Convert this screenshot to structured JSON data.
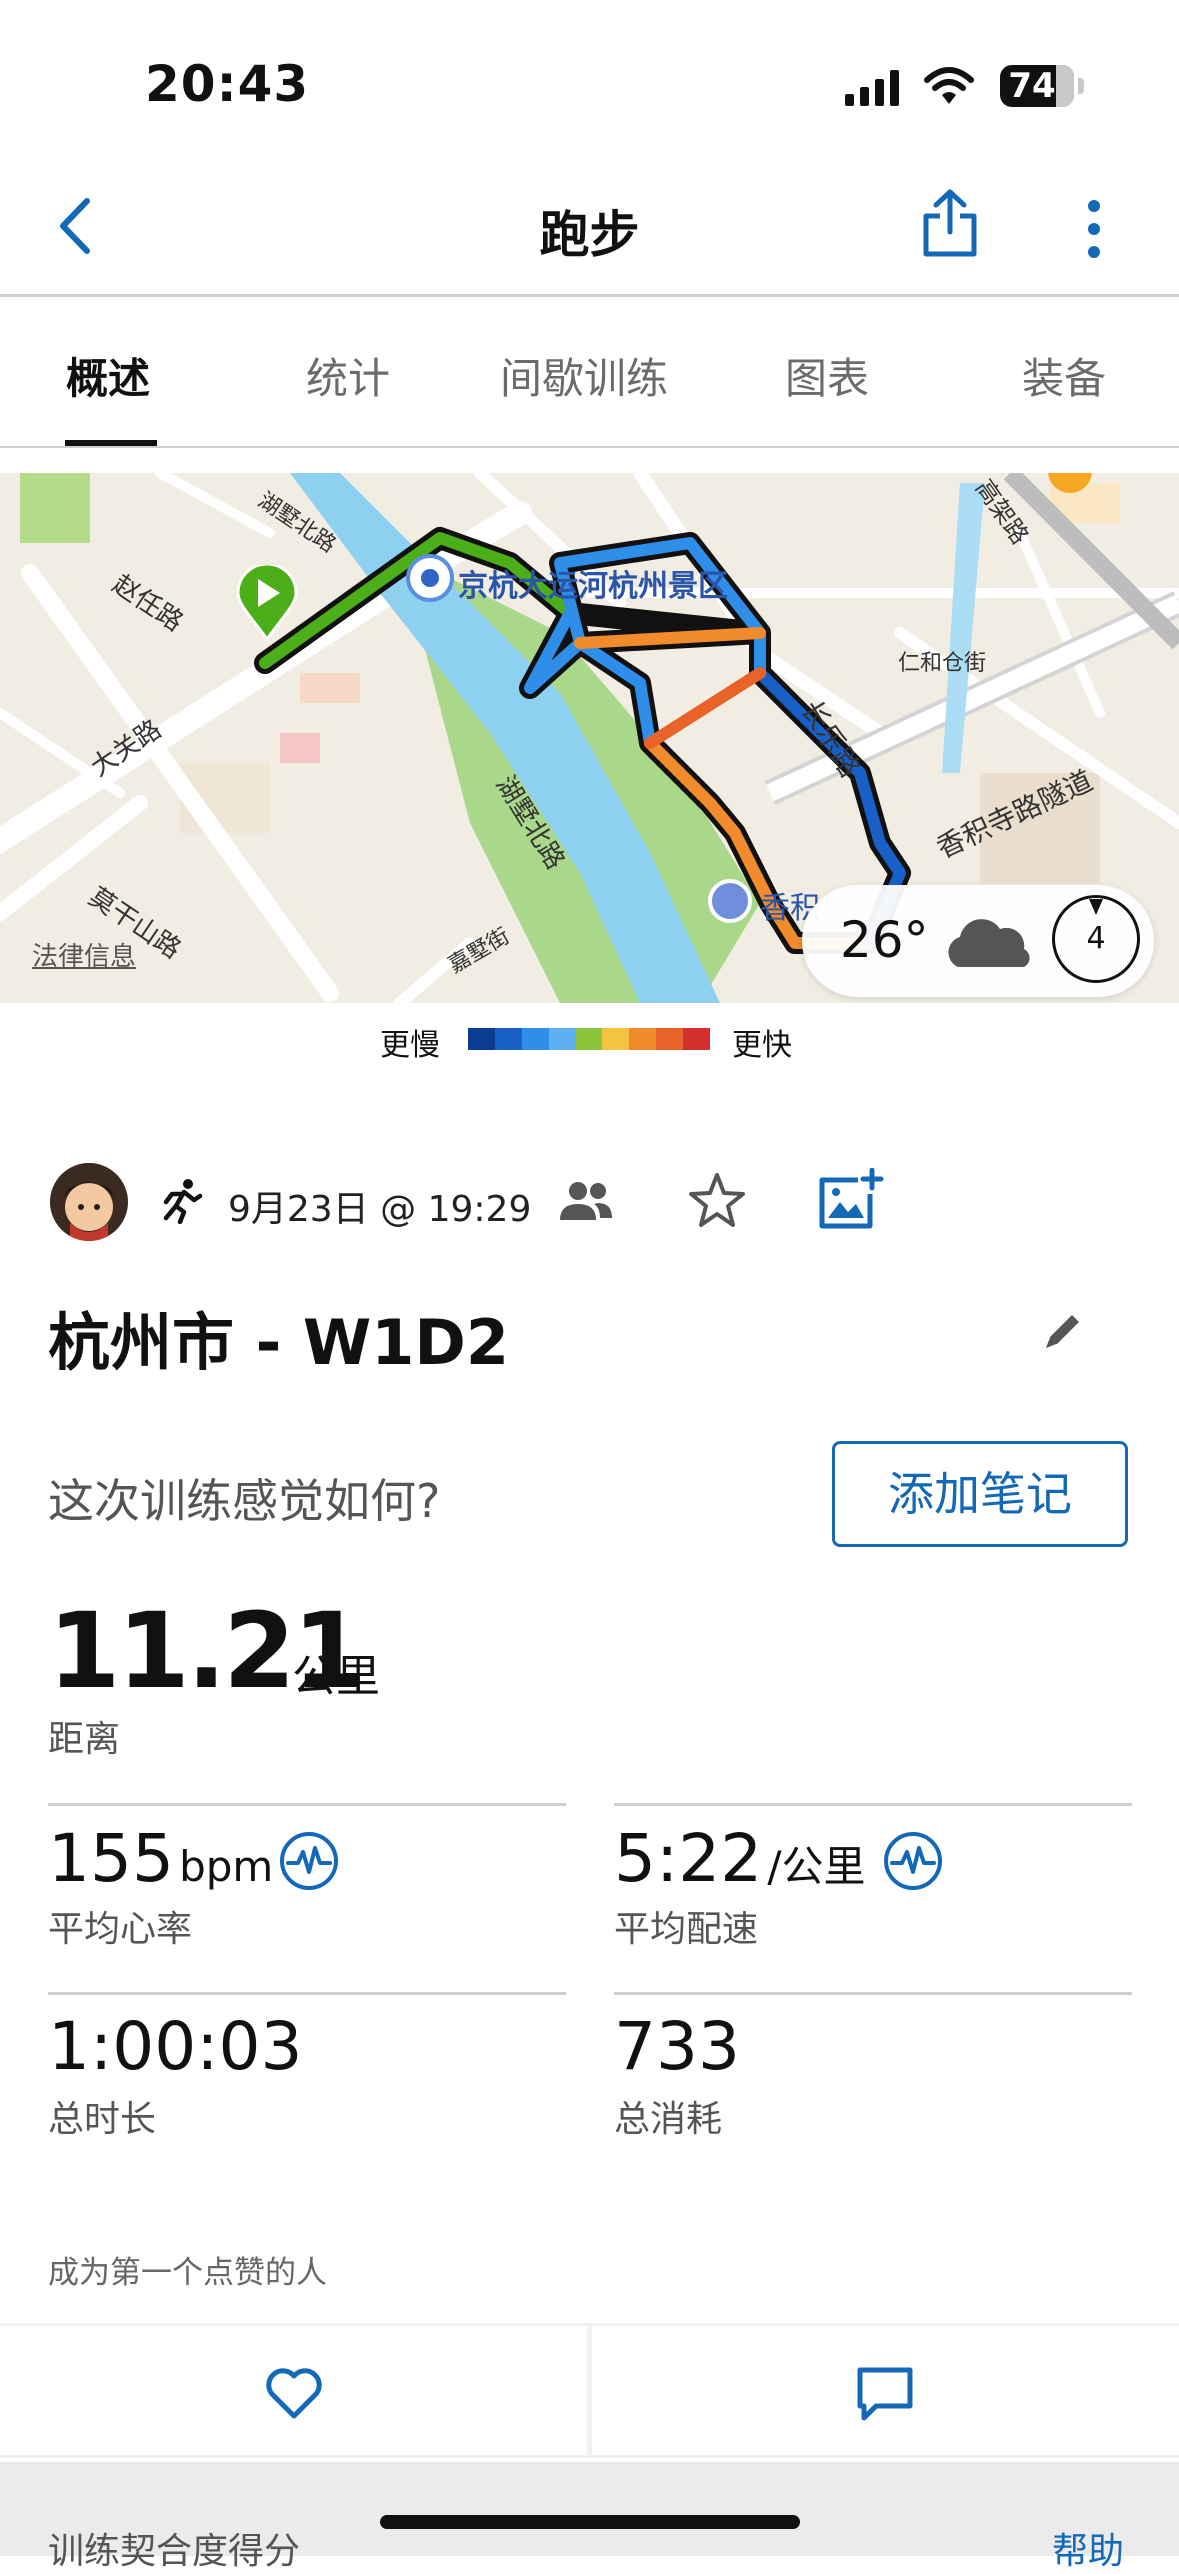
{
  "status_bar": {
    "time": "20:43",
    "battery": "74"
  },
  "nav": {
    "title": "跑步"
  },
  "tabs": [
    {
      "label": "概述",
      "active": true
    },
    {
      "label": "统计"
    },
    {
      "label": "间歇训练"
    },
    {
      "label": "图表"
    },
    {
      "label": "装备"
    }
  ],
  "map": {
    "place_labels": {
      "canal": "京杭大运河杭州景区",
      "zhaoren": "赵任路",
      "daguan": "大关路",
      "moganshan": "莫干山路",
      "hushubei_top": "湖墅北路",
      "hushubei_mid": "湖墅北路",
      "changle": "长乐路",
      "xiangji": "香积寺路隧道",
      "jiashu": "嘉墅街",
      "renhe": "仁和仓街",
      "gaojia": "高架路",
      "xiangji_short": "香积"
    },
    "legal": "法律信息",
    "weather": {
      "temp": "26°",
      "wind": "4"
    }
  },
  "legend": {
    "slow": "更慢",
    "fast": "更快",
    "colors": [
      "#0a3d91",
      "#1860c8",
      "#2f8ee8",
      "#5fb0f2",
      "#8cc43a",
      "#f5c342",
      "#f18b2b",
      "#e8622a",
      "#d42f2f"
    ]
  },
  "activity": {
    "date": "9月23日 @ 19:29",
    "title": "杭州市 - W1D2",
    "feel_question": "这次训练感觉如何?",
    "add_note": "添加笔记",
    "distance": {
      "value": "11.21",
      "unit": "公里",
      "label": "距离"
    },
    "stats": [
      {
        "value": "155",
        "unit": "bpm",
        "label": "平均心率"
      },
      {
        "value": "5:22",
        "unit": "/公里",
        "label": "平均配速"
      },
      {
        "value": "1:00:03",
        "unit": "",
        "label": "总时长"
      },
      {
        "value": "733",
        "unit": "",
        "label": "总消耗"
      }
    ],
    "likes": "成为第一个点赞的人"
  },
  "footer": {
    "title": "训练契合度得分",
    "help": "帮助"
  },
  "colors": {
    "accent": "#1468b8",
    "start_pin": "#4caf1a"
  },
  "icons": [
    "back-chevron-icon",
    "share-icon",
    "more-vertical-icon",
    "run-icon",
    "group-icon",
    "star-icon",
    "add-photo-icon",
    "edit-pencil-icon",
    "heart-rate-icon",
    "heart-icon",
    "comment-icon",
    "cloud-icon",
    "compass-icon",
    "start-pin-icon",
    "poi-pin-icon",
    "signal-icon",
    "wifi-icon",
    "battery-icon"
  ]
}
